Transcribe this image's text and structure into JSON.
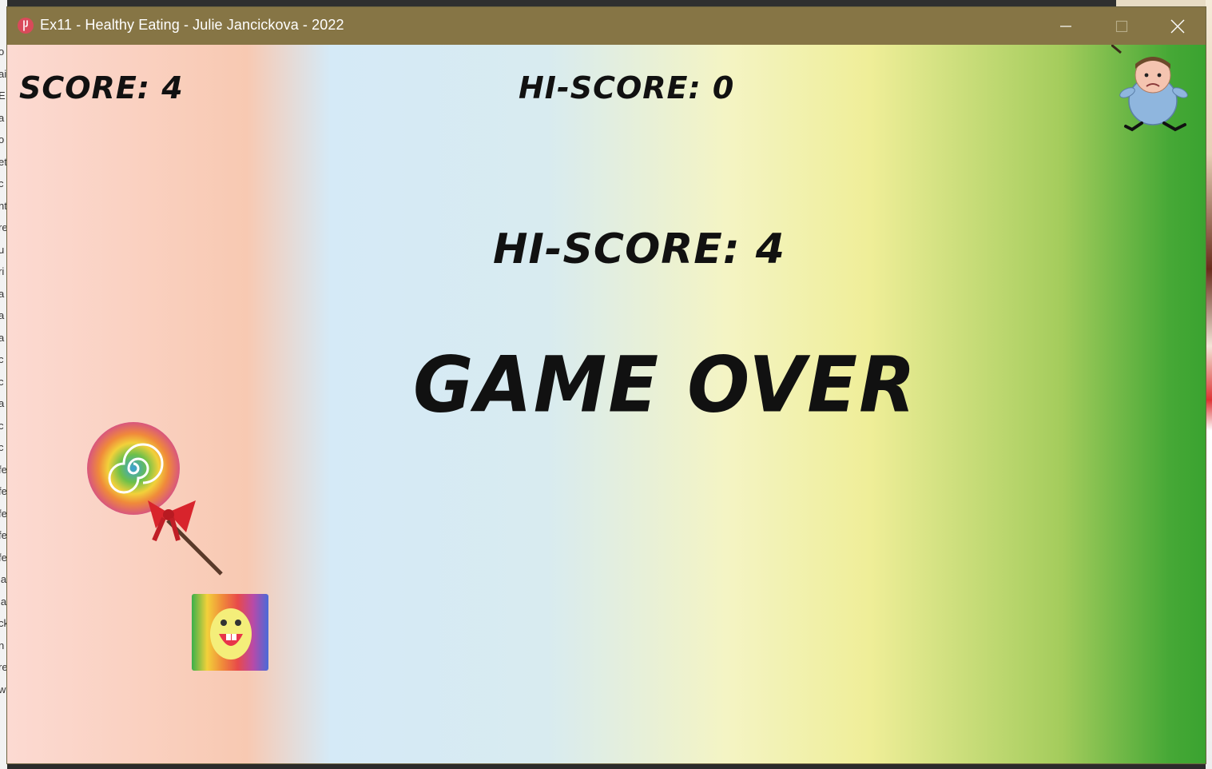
{
  "window": {
    "title": "Ex11 - Healthy Eating - Julie Jancickova - 2022",
    "titlebar_color": "#867545",
    "controls": {
      "minimize": "minimize-icon",
      "maximize": "maximize-icon",
      "close": "close-icon"
    }
  },
  "game": {
    "score_label": "SCORE: 4",
    "hiscore_top_label": "HI-SCORE: 0",
    "hiscore_center_label": "HI-SCORE: 4",
    "game_over_label": "GAME OVER",
    "score": 4,
    "hiscore_previous": 0,
    "hiscore_new": 4,
    "sprites": [
      "player-character",
      "lollipop",
      "candy-smiley-box"
    ]
  },
  "desktop_left_fragments": [
    "o",
    "ai",
    "E",
    "a",
    "o",
    "et",
    "c",
    "nt",
    "re",
    "u",
    "ri",
    "a",
    "a",
    "a",
    "c",
    "c",
    "a",
    "c",
    "c",
    "fe",
    "fe",
    "fe",
    "fe",
    "fe",
    "la",
    "la",
    "ck",
    "n",
    "re",
    "w"
  ]
}
